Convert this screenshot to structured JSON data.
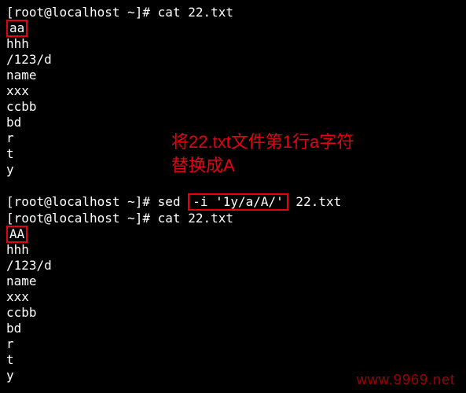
{
  "prompt": {
    "open": "[",
    "userhost": "root@localhost",
    "tilde": " ~",
    "close": "]",
    "hash": "# "
  },
  "block1": {
    "cmd": "cat 22.txt",
    "boxed_line": "aa",
    "lines": [
      "hhh",
      "/123/d",
      "name",
      "xxx",
      "ccbb",
      "bd",
      "r",
      "t",
      "y"
    ]
  },
  "annotation": {
    "line1": "将22.txt文件第1行a字符",
    "line2": "替换成A"
  },
  "block2": {
    "cmd_sed_pre": "sed ",
    "cmd_sed_boxed": "-i '1y/a/A/'",
    "cmd_sed_post": " 22.txt",
    "cmd_cat": "cat 22.txt",
    "boxed_line": "AA",
    "lines": [
      "hhh",
      "/123/d",
      "name",
      "xxx",
      "ccbb",
      "bd",
      "r",
      "t",
      "y"
    ]
  },
  "watermark": "www.9969.net"
}
